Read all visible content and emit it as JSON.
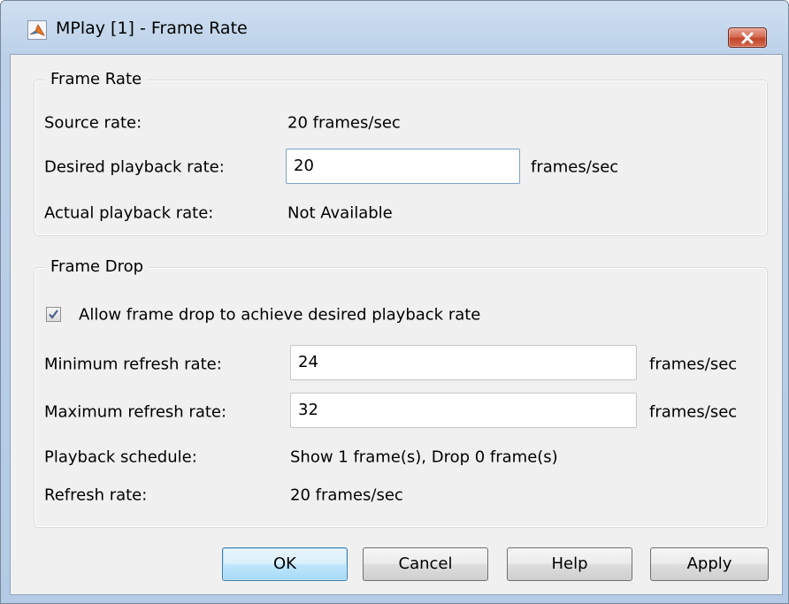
{
  "window": {
    "title": "MPlay [1] - Frame Rate",
    "icon": "matlab-icon",
    "close_icon": "close-icon"
  },
  "frame_rate_group": {
    "legend": "Frame Rate",
    "source_rate_label": "Source rate:",
    "source_rate_value": "20 frames/sec",
    "desired_playback_label": "Desired playback rate:",
    "desired_playback_value": "20",
    "desired_playback_unit": "frames/sec",
    "actual_playback_label": "Actual playback rate:",
    "actual_playback_value": "Not Available"
  },
  "frame_drop_group": {
    "legend": "Frame Drop",
    "allow_drop_checked": true,
    "allow_drop_label": "Allow frame drop to achieve desired playback rate",
    "min_refresh_label": "Minimum refresh rate:",
    "min_refresh_value": "24",
    "min_refresh_unit": "frames/sec",
    "max_refresh_label": "Maximum refresh rate:",
    "max_refresh_value": "32",
    "max_refresh_unit": "frames/sec",
    "schedule_label": "Playback schedule:",
    "schedule_value": "Show 1 frame(s), Drop 0 frame(s)",
    "refresh_rate_label": "Refresh rate:",
    "refresh_rate_value": "20 frames/sec"
  },
  "buttons": {
    "ok": "OK",
    "cancel": "Cancel",
    "help": "Help",
    "apply": "Apply"
  },
  "colors": {
    "title_bar": "#bcd1e8",
    "client_bg": "#f0f0f0",
    "close_button": "#c2452b",
    "default_button": "#bee6fd",
    "checkmark": "#4a5e8c"
  }
}
